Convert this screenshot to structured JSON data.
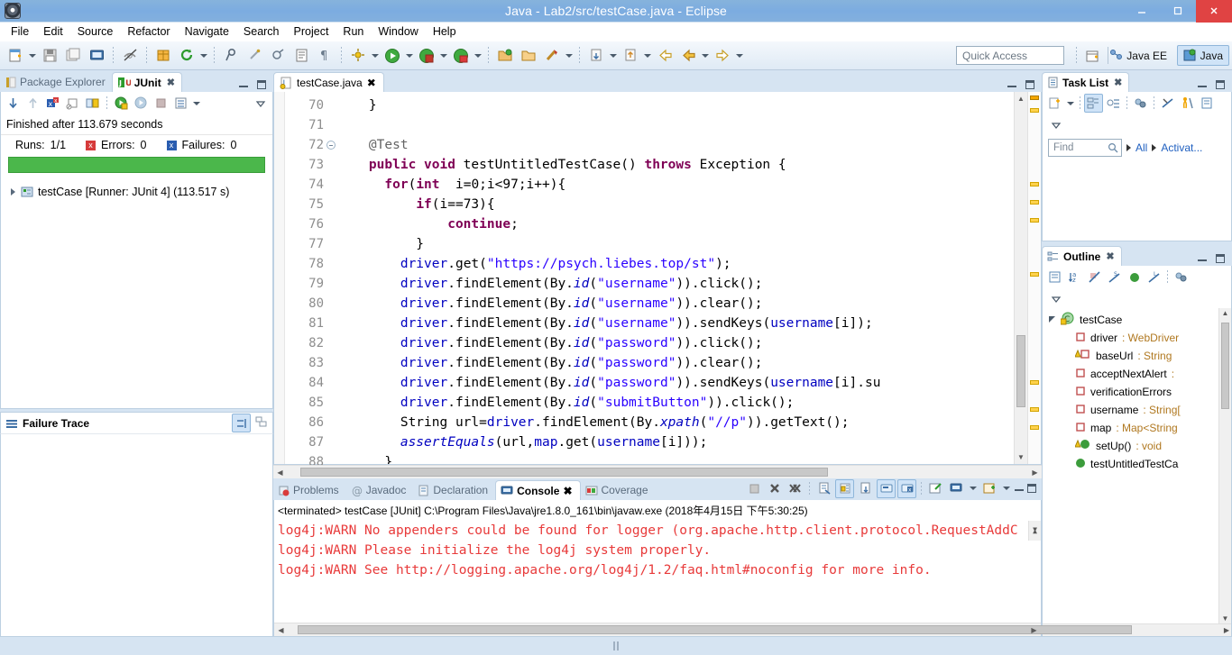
{
  "window": {
    "title": "Java - Lab2/src/testCase.java - Eclipse",
    "minimize_label": "–",
    "maximize_label": "❐",
    "close_label": "✕"
  },
  "menubar": {
    "items": [
      "File",
      "Edit",
      "Source",
      "Refactor",
      "Navigate",
      "Search",
      "Project",
      "Run",
      "Window",
      "Help"
    ]
  },
  "toolbar": {
    "quick_access_placeholder": "Quick Access",
    "perspectives": [
      {
        "id": "java-ee",
        "label": "Java EE",
        "active": false
      },
      {
        "id": "java",
        "label": "Java",
        "active": true
      }
    ]
  },
  "junit": {
    "tabs": [
      {
        "label": "Package Explorer",
        "active": false
      },
      {
        "label": "JUnit",
        "active": true
      }
    ],
    "status": "Finished after 113.679 seconds",
    "counts": {
      "runs_label": "Runs:",
      "runs_value": "1/1",
      "errors_label": "Errors:",
      "errors_value": "0",
      "failures_label": "Failures:",
      "failures_value": "0"
    },
    "progress_color": "#4bb74b",
    "tree": [
      {
        "label": "testCase [Runner: JUnit 4] (113.517 s)"
      }
    ],
    "failure_trace_title": "Failure Trace"
  },
  "editor": {
    "tab_label": "testCase.java",
    "first_line": 70,
    "lines": [
      {
        "n": 70,
        "fold": false,
        "tokens": [
          {
            "t": "    }",
            "c": "plain"
          }
        ]
      },
      {
        "n": 71,
        "fold": false,
        "tokens": []
      },
      {
        "n": 72,
        "fold": true,
        "tokens": [
          {
            "t": "    ",
            "c": "plain"
          },
          {
            "t": "@Test",
            "c": "ann"
          }
        ]
      },
      {
        "n": 73,
        "fold": false,
        "tokens": [
          {
            "t": "    ",
            "c": "plain"
          },
          {
            "t": "public void",
            "c": "kw"
          },
          {
            "t": " testUntitledTestCase() ",
            "c": "plain"
          },
          {
            "t": "throws",
            "c": "kw"
          },
          {
            "t": " Exception {",
            "c": "plain"
          }
        ]
      },
      {
        "n": 74,
        "fold": false,
        "tokens": [
          {
            "t": "      ",
            "c": "plain"
          },
          {
            "t": "for",
            "c": "kw"
          },
          {
            "t": "(",
            "c": "plain"
          },
          {
            "t": "int",
            "c": "kw"
          },
          {
            "t": "  i=0;i<97;i++){",
            "c": "plain"
          }
        ]
      },
      {
        "n": 75,
        "fold": false,
        "tokens": [
          {
            "t": "          ",
            "c": "plain"
          },
          {
            "t": "if",
            "c": "kw"
          },
          {
            "t": "(i==73){",
            "c": "plain"
          }
        ]
      },
      {
        "n": 76,
        "fold": false,
        "tokens": [
          {
            "t": "              ",
            "c": "plain"
          },
          {
            "t": "continue",
            "c": "kw"
          },
          {
            "t": ";",
            "c": "plain"
          }
        ]
      },
      {
        "n": 77,
        "fold": false,
        "tokens": [
          {
            "t": "          }",
            "c": "plain"
          }
        ]
      },
      {
        "n": 78,
        "fold": false,
        "tokens": [
          {
            "t": "        ",
            "c": "plain"
          },
          {
            "t": "driver",
            "c": "fld"
          },
          {
            "t": ".get(",
            "c": "plain"
          },
          {
            "t": "\"https://psych.liebes.top/st\"",
            "c": "str"
          },
          {
            "t": ");",
            "c": "plain"
          }
        ]
      },
      {
        "n": 79,
        "fold": false,
        "tokens": [
          {
            "t": "        ",
            "c": "plain"
          },
          {
            "t": "driver",
            "c": "fld"
          },
          {
            "t": ".findElement(By.",
            "c": "plain"
          },
          {
            "t": "id",
            "c": "stat"
          },
          {
            "t": "(",
            "c": "plain"
          },
          {
            "t": "\"username\"",
            "c": "str"
          },
          {
            "t": ")).click();",
            "c": "plain"
          }
        ]
      },
      {
        "n": 80,
        "fold": false,
        "tokens": [
          {
            "t": "        ",
            "c": "plain"
          },
          {
            "t": "driver",
            "c": "fld"
          },
          {
            "t": ".findElement(By.",
            "c": "plain"
          },
          {
            "t": "id",
            "c": "stat"
          },
          {
            "t": "(",
            "c": "plain"
          },
          {
            "t": "\"username\"",
            "c": "str"
          },
          {
            "t": ")).clear();",
            "c": "plain"
          }
        ]
      },
      {
        "n": 81,
        "fold": false,
        "tokens": [
          {
            "t": "        ",
            "c": "plain"
          },
          {
            "t": "driver",
            "c": "fld"
          },
          {
            "t": ".findElement(By.",
            "c": "plain"
          },
          {
            "t": "id",
            "c": "stat"
          },
          {
            "t": "(",
            "c": "plain"
          },
          {
            "t": "\"username\"",
            "c": "str"
          },
          {
            "t": ")).sendKeys(",
            "c": "plain"
          },
          {
            "t": "username",
            "c": "fld"
          },
          {
            "t": "[i]);",
            "c": "plain"
          }
        ]
      },
      {
        "n": 82,
        "fold": false,
        "tokens": [
          {
            "t": "        ",
            "c": "plain"
          },
          {
            "t": "driver",
            "c": "fld"
          },
          {
            "t": ".findElement(By.",
            "c": "plain"
          },
          {
            "t": "id",
            "c": "stat"
          },
          {
            "t": "(",
            "c": "plain"
          },
          {
            "t": "\"password\"",
            "c": "str"
          },
          {
            "t": ")).click();",
            "c": "plain"
          }
        ]
      },
      {
        "n": 83,
        "fold": false,
        "tokens": [
          {
            "t": "        ",
            "c": "plain"
          },
          {
            "t": "driver",
            "c": "fld"
          },
          {
            "t": ".findElement(By.",
            "c": "plain"
          },
          {
            "t": "id",
            "c": "stat"
          },
          {
            "t": "(",
            "c": "plain"
          },
          {
            "t": "\"password\"",
            "c": "str"
          },
          {
            "t": ")).clear();",
            "c": "plain"
          }
        ]
      },
      {
        "n": 84,
        "fold": false,
        "tokens": [
          {
            "t": "        ",
            "c": "plain"
          },
          {
            "t": "driver",
            "c": "fld"
          },
          {
            "t": ".findElement(By.",
            "c": "plain"
          },
          {
            "t": "id",
            "c": "stat"
          },
          {
            "t": "(",
            "c": "plain"
          },
          {
            "t": "\"password\"",
            "c": "str"
          },
          {
            "t": ")).sendKeys(",
            "c": "plain"
          },
          {
            "t": "username",
            "c": "fld"
          },
          {
            "t": "[i].su",
            "c": "plain"
          }
        ]
      },
      {
        "n": 85,
        "fold": false,
        "tokens": [
          {
            "t": "        ",
            "c": "plain"
          },
          {
            "t": "driver",
            "c": "fld"
          },
          {
            "t": ".findElement(By.",
            "c": "plain"
          },
          {
            "t": "id",
            "c": "stat"
          },
          {
            "t": "(",
            "c": "plain"
          },
          {
            "t": "\"submitButton\"",
            "c": "str"
          },
          {
            "t": ")).click();",
            "c": "plain"
          }
        ]
      },
      {
        "n": 86,
        "fold": false,
        "tokens": [
          {
            "t": "        String url=",
            "c": "plain"
          },
          {
            "t": "driver",
            "c": "fld"
          },
          {
            "t": ".findElement(By.",
            "c": "plain"
          },
          {
            "t": "xpath",
            "c": "stat"
          },
          {
            "t": "(",
            "c": "plain"
          },
          {
            "t": "\"//p\"",
            "c": "str"
          },
          {
            "t": ")).getText();",
            "c": "plain"
          }
        ]
      },
      {
        "n": 87,
        "fold": false,
        "tokens": [
          {
            "t": "        ",
            "c": "plain"
          },
          {
            "t": "assertEquals",
            "c": "stat"
          },
          {
            "t": "(url,",
            "c": "plain"
          },
          {
            "t": "map",
            "c": "fld"
          },
          {
            "t": ".get(",
            "c": "plain"
          },
          {
            "t": "username",
            "c": "fld"
          },
          {
            "t": "[i]));",
            "c": "plain"
          }
        ]
      },
      {
        "n": 88,
        "fold": false,
        "tokens": [
          {
            "t": "      }",
            "c": "plain"
          }
        ]
      }
    ]
  },
  "console": {
    "tabs": [
      {
        "label": "Problems",
        "active": false
      },
      {
        "label": "Javadoc",
        "active": false
      },
      {
        "label": "Declaration",
        "active": false
      },
      {
        "label": "Console",
        "active": true
      },
      {
        "label": "Coverage",
        "active": false
      }
    ],
    "header": "<terminated> testCase [JUnit] C:\\Program Files\\Java\\jre1.8.0_161\\bin\\javaw.exe (2018年4月15日 下午5:30:25)",
    "output_color": "#e83a3a",
    "output": [
      "log4j:WARN No appenders could be found for logger (org.apache.http.client.protocol.RequestAddC",
      "log4j:WARN Please initialize the log4j system properly.",
      "log4j:WARN See http://logging.apache.org/log4j/1.2/faq.html#noconfig for more info."
    ]
  },
  "task_list": {
    "tab_label": "Task List",
    "find_placeholder": "Find",
    "filter_all": "All",
    "filter_activate": "Activat..."
  },
  "outline": {
    "tab_label": "Outline",
    "items": [
      {
        "icon": "class-icon",
        "name": "testCase",
        "type": "",
        "indent": 0,
        "expander": true
      },
      {
        "icon": "field-private-icon",
        "name": "driver ",
        "type": ": WebDriver",
        "indent": 1,
        "expander": false
      },
      {
        "icon": "field-warning-icon",
        "name": "baseUrl ",
        "type": ": String",
        "indent": 1,
        "expander": false
      },
      {
        "icon": "field-private-icon",
        "name": "acceptNextAlert ",
        "type": ":",
        "indent": 1,
        "expander": false
      },
      {
        "icon": "field-private-icon",
        "name": "verificationErrors",
        "type": "",
        "indent": 1,
        "expander": false
      },
      {
        "icon": "field-private-icon",
        "name": "username ",
        "type": ": String[",
        "indent": 1,
        "expander": false
      },
      {
        "icon": "field-private-icon",
        "name": "map ",
        "type": ": Map<String",
        "indent": 1,
        "expander": false
      },
      {
        "icon": "method-warning-icon",
        "name": "setUp() ",
        "type": ": void",
        "indent": 1,
        "expander": false
      },
      {
        "icon": "method-public-icon",
        "name": "testUntitledTestCa",
        "type": "",
        "indent": 1,
        "expander": false
      }
    ]
  }
}
